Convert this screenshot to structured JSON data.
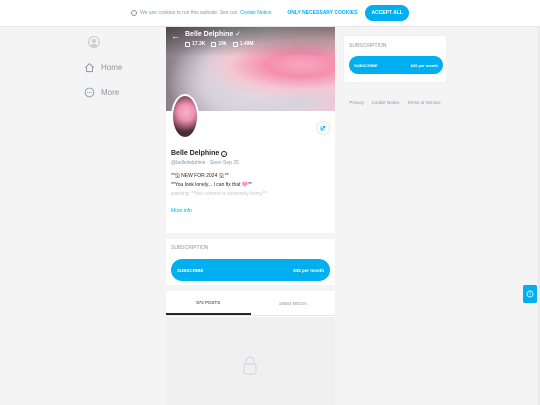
{
  "cookie": {
    "text": "We use cookies to run this website. See our",
    "link": "Cookie Notice",
    "necessary_btn": "ONLY NECESSARY COOKIES",
    "accept_btn": "ACCEPT ALL"
  },
  "sidebar": {
    "items": [
      {
        "label": "Home",
        "icon": "home-icon"
      },
      {
        "label": "More",
        "icon": "more-icon"
      }
    ]
  },
  "profile": {
    "banner_name": "Belle Delphine",
    "stats": {
      "photos": "17.3K",
      "videos": "19k",
      "likes": "1.49M"
    },
    "name": "Belle Delphine",
    "handle_line": "@belledelphine · Seen Sep 25",
    "bio_line1": "**🏠NEW FOR 2024 🏠**",
    "bio_line2": "**You look lonely... I can fix that 🩷**",
    "bio_line3": "warning: **this content is extremely horny**",
    "more_info": "More info"
  },
  "subscription": {
    "label": "SUBSCRIPTION",
    "button_label": "SUBSCRIBE",
    "price": "$35 per month"
  },
  "tabs": [
    {
      "label": "972 POSTS",
      "active": true
    },
    {
      "label": "18084 MEDIA",
      "active": false
    }
  ],
  "footer": {
    "links": [
      "Privacy",
      "Cookie Notice",
      "Terms of Service"
    ]
  },
  "colors": {
    "accent": "#00aff0",
    "text": "#242529",
    "muted": "#8a96a3"
  }
}
